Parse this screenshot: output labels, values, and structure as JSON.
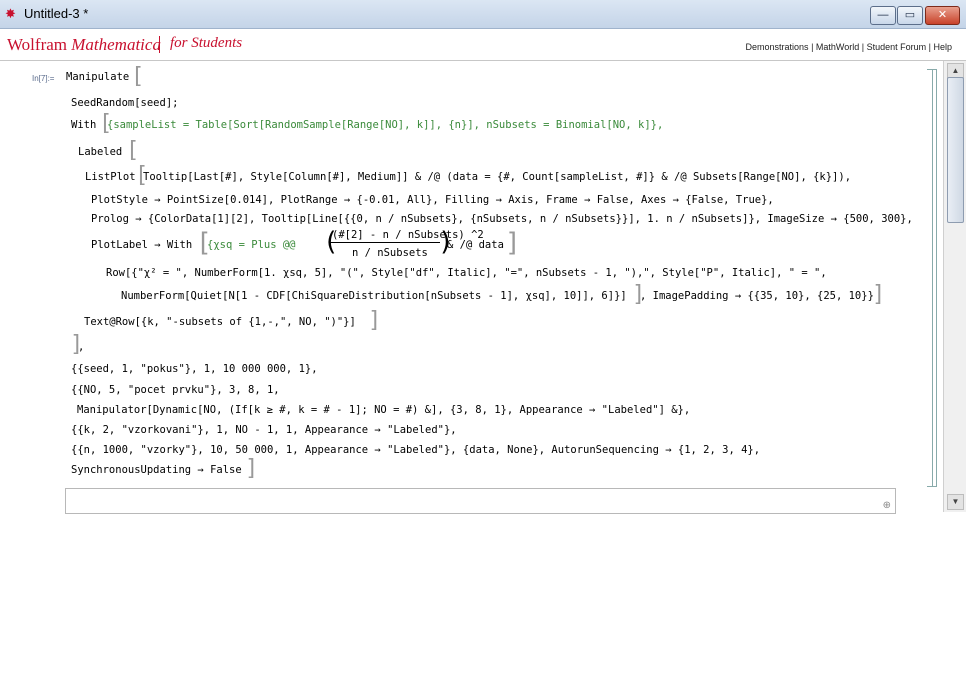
{
  "window": {
    "title": "Untitled-3 *",
    "minimize": "—",
    "maximize": "▭",
    "close": "✕"
  },
  "brand": {
    "name_part1": "Wolfram",
    "name_part2": "Mathematica",
    "edition": "for Students"
  },
  "links": [
    "Demonstrations",
    "MathWorld",
    "Student Forum",
    "Help"
  ],
  "cell": {
    "label": "In[7]:="
  },
  "code": {
    "l1": "Manipulate",
    "l2": "SeedRandom[seed];",
    "l3a": "With",
    "l3b": "{sampleList = Table[Sort[RandomSample[Range[NO], k]], {n}], nSubsets = Binomial[NO, k]},",
    "l4": "Labeled",
    "l5a": "ListPlot",
    "l5b": "Tooltip[Last[#], Style[Column[#], Medium]] & /@ (data = {#, Count[sampleList, #]} & /@ Subsets[Range[NO], {k}]),",
    "l6": "PlotStyle → PointSize[0.014], PlotRange → {-0.01, All}, Filling → Axis, Frame → False, Axes → {False, True},",
    "l7": "Prolog → {ColorData[1][2], Tooltip[Line[{{0, n / nSubsets}, {nSubsets, n / nSubsets}}], 1. n / nSubsets]}, ImageSize → {500, 300},",
    "l8a": "PlotLabel → With",
    "l8b": "{χsq = Plus @@",
    "l8num": "(#[2] - n / nSubsets) ^2",
    "l8den": "n / nSubsets",
    "l8c": "& /@ data",
    "l9": "Row[{\"χ² = \", NumberForm[1. χsq, 5], \"(\", Style[\"df\", Italic], \"=\", nSubsets - 1, \"),\", Style[\"P\", Italic], \" = \",",
    "l10a": "NumberForm[Quiet[N[1 - CDF[ChiSquareDistribution[nSubsets - 1], χsq], 10]], 6]}]",
    "l10b": ", ImagePadding → {{35, 10}, {25, 10}}",
    "l11": "Text@Row[{k, \"-subsets of {1,-,\", NO, \")\"}]",
    "l12": ",",
    "l13": "{{seed, 1, \"pokus\"}, 1, 10 000 000, 1},",
    "l14": "{{NO, 5, \"pocet prvku\"}, 3, 8, 1,",
    "l15": "Manipulator[Dynamic[NO, (If[k ≥ #, k = # - 1]; NO = #) &], {3, 8, 1}, Appearance → \"Labeled\"] &},",
    "l16": "{{k, 2, \"vzorkovani\"}, 1, NO - 1, 1, Appearance → \"Labeled\"},",
    "l17": "{{n, 1000, \"vzorky\"}, 10, 50 000, 1, Appearance → \"Labeled\"}, {data, None}, AutorunSequencing → {1, 2, 3, 4},",
    "l18": "SynchronousUpdating → False"
  }
}
